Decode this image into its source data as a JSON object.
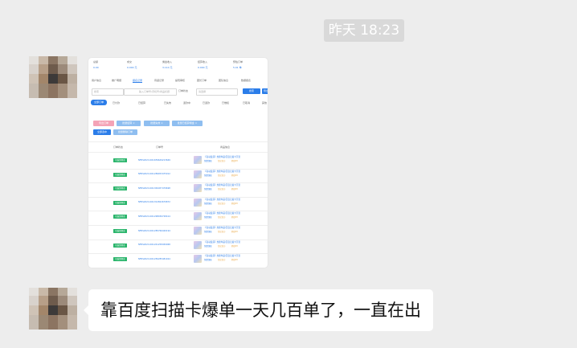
{
  "chat": {
    "timestamp": "昨天 18:23",
    "messages": [
      {
        "type": "image",
        "sender_avatar": "avatar",
        "screenshot": {
          "stats_labels": [
            "总额",
            "成交",
            "佣金收入",
            "结算收入",
            "预估订单"
          ],
          "stats_values": [
            "0.00",
            "0.000 元",
            "3.110 元",
            "0.000 元",
            "5.01 单"
          ],
          "tabs": [
            "用户信息",
            "推广明细",
            "报名记录",
            "待返记录",
            "提现审核",
            "团长订单",
            "团队信息",
            "数据报表"
          ],
          "active_tab_index": 2,
          "search": {
            "input1_placeholder": "搜索",
            "input2_placeholder": "输入订单号/手机号/商品标题",
            "date_label": "订单状态",
            "date_placeholder": "请选择",
            "search_button": "搜索",
            "reset_button": "导出"
          },
          "filters": [
            "全部订单",
            "已付款",
            "已结算",
            "已失效",
            "退款中",
            "已退款",
            "已维权",
            "已取消",
            "其他"
          ],
          "chips": [
            "导出订单",
            "批量结算 ×",
            "批量失效 ×",
            "批量已结算佣金 ×"
          ],
          "chip_colors": [
            "#f4a3b6",
            "#8fbef0",
            "#8fbef0",
            "#8fbef0"
          ],
          "action_buttons": [
            "全部选中",
            "批量删除订单"
          ],
          "table_headers": [
            "订单状态",
            "订单号",
            "商品信息"
          ],
          "rows": [
            {
              "status": "已结算佣金",
              "order_no": "NFRS20211041659649213669",
              "title": "【自动发货】热搜单品/百度扫描卡引流",
              "tags": [
                "免费领取",
                "淘宝官方",
                "佣金¥3"
              ]
            },
            {
              "status": "已结算佣金",
              "order_no": "NFRS20211041289053475912",
              "title": "【自动发货】热搜单品/百度扫描卡引流",
              "tags": [
                "免费领取",
                "淘宝官方",
                "佣金¥3"
              ]
            },
            {
              "status": "已结算佣金",
              "order_no": "NFRS20211041349457479698",
              "title": "【自动发货】热搜单品/百度扫描卡引流",
              "tags": [
                "免费领取",
                "淘宝官方",
                "佣金¥3"
              ]
            },
            {
              "status": "已结算佣金",
              "order_no": "NFRS20211041312822679872",
              "title": "【自动发货】热搜单品/百度扫描卡引流",
              "tags": [
                "免费领取",
                "淘宝官方",
                "佣金¥3"
              ]
            },
            {
              "status": "已结算佣金",
              "order_no": "NFRS20211041298036728414",
              "title": "【自动发货】热搜单品/百度扫描卡引流",
              "tags": [
                "免费领取",
                "淘宝官方",
                "佣金¥3"
              ]
            },
            {
              "status": "已结算佣金",
              "order_no": "NFRS20211041285766420194",
              "title": "【自动发货】热搜单品/百度扫描卡引流",
              "tags": [
                "免费领取",
                "淘宝官方",
                "佣金¥3"
              ]
            },
            {
              "status": "已结算佣金",
              "order_no": "NFRS20211041241258450968",
              "title": "【自动发货】热搜单品/百度扫描卡引流",
              "tags": [
                "免费领取",
                "淘宝官方",
                "佣金¥3"
              ]
            },
            {
              "status": "已结算佣金",
              "order_no": "NFRS20211041256285481024",
              "title": "【自动发货】热搜单品/百度扫描卡引流",
              "tags": [
                "免费领取",
                "淘宝官方",
                "佣金¥3"
              ]
            }
          ]
        }
      },
      {
        "type": "text",
        "sender_avatar": "avatar",
        "text": "靠百度扫描卡爆单一天几百单了，一直在出"
      }
    ]
  },
  "colors": {
    "background": "#ededed",
    "bubble": "#ffffff",
    "accent_blue": "#2b7de9",
    "status_green": "#28b46a",
    "timestamp_bg": "#d9d9d9"
  }
}
